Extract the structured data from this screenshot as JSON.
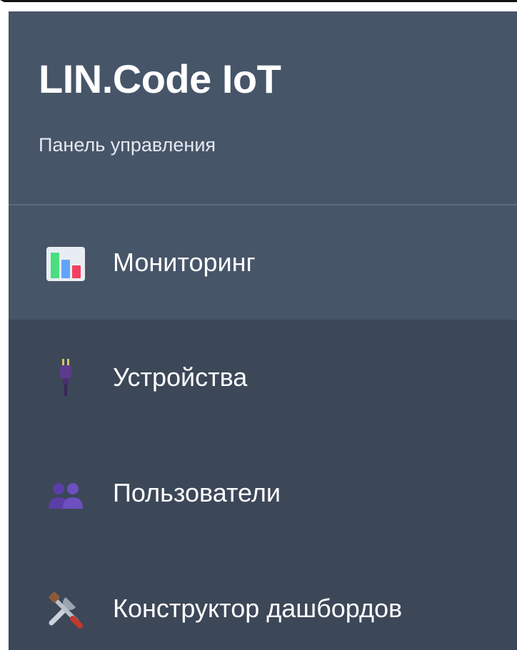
{
  "brand": {
    "title": "LIN.Code IoT",
    "subtitle": "Панель управления"
  },
  "nav": {
    "items": [
      {
        "label": "Мониторинг",
        "icon": "bar-chart-icon",
        "active": true
      },
      {
        "label": "Устройства",
        "icon": "plug-icon",
        "active": false
      },
      {
        "label": "Пользователи",
        "icon": "users-icon",
        "active": false
      },
      {
        "label": "Конструктор дашбордов",
        "icon": "tools-icon",
        "active": false
      }
    ]
  },
  "colors": {
    "sidebar_bg": "#3c4758",
    "active_bg": "#475569",
    "text": "#ffffff"
  }
}
